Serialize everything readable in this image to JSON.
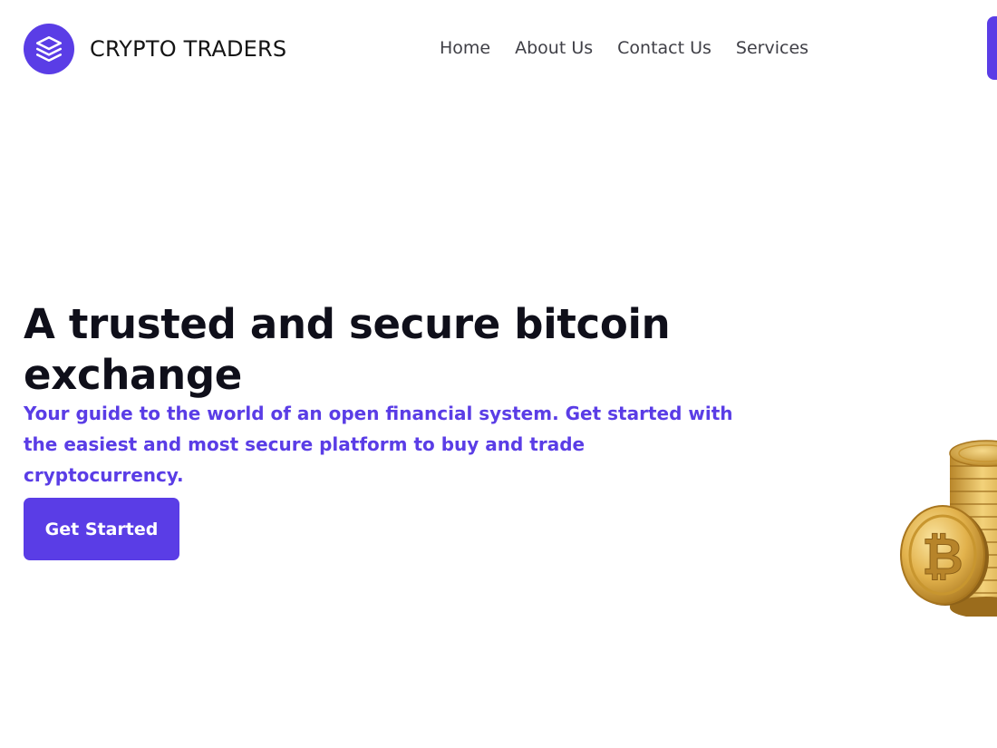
{
  "brand": {
    "name": "CRYPTO TRADERS",
    "logo_icon": "layers-stack-icon",
    "accent_color": "#5a3de6"
  },
  "nav": {
    "items": [
      {
        "label": "Home"
      },
      {
        "label": "About Us"
      },
      {
        "label": "Contact Us"
      },
      {
        "label": "Services"
      }
    ]
  },
  "hero": {
    "title": "A trusted and secure bitcoin exchange",
    "subtitle": "Your guide to the world of an open financial system. Get started with the easiest and most secure platform to buy and trade cryptocurrency.",
    "cta_label": "Get Started",
    "illustration_icon": "bitcoin-coins-icon"
  },
  "colors": {
    "accent": "#5a3de6",
    "heading": "#0f0f1a",
    "nav_text": "#3f3f46",
    "coin_gold": "#d4a73a"
  }
}
